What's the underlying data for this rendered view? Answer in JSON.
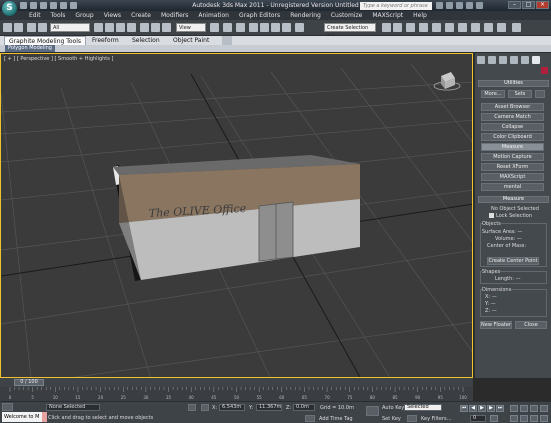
{
  "titlebar": {
    "logo_glyph": "S",
    "title": "Autodesk 3ds Max 2011 - Unregistered Version   Untitled",
    "search_placeholder": "Type a keyword or phrase",
    "window_buttons": [
      "–",
      "□",
      "×"
    ]
  },
  "menubar": {
    "items": [
      "Edit",
      "Tools",
      "Group",
      "Views",
      "Create",
      "Modifiers",
      "Animation",
      "Graph Editors",
      "Rendering",
      "Customize",
      "MAXScript",
      "Help"
    ]
  },
  "maintoolbar": {
    "selection_filter": "All",
    "ref_coord": "View",
    "named_selection": "Create Selection Set"
  },
  "ribbon": {
    "tabs": [
      "Graphite Modeling Tools",
      "Freeform",
      "Selection",
      "Object Paint"
    ],
    "active_tab": "Graphite Modeling Tools",
    "sub_label": "Polygon Modeling"
  },
  "viewport": {
    "label": "[ + ] [ Perspective ] [ Smooth + Highlights ]",
    "sign_text": "The OLIVE Office"
  },
  "cmdpanel": {
    "utilities": {
      "header": "Utilities",
      "more": "More...",
      "sets": "Sets",
      "items": [
        "Asset Browser",
        "Camera Match",
        "Collapse",
        "Color Clipboard",
        "Measure",
        "Motion Capture",
        "Reset XForm",
        "MAXScript",
        "mental"
      ]
    },
    "measure": {
      "header": "Measure",
      "no_selection": "No Object Selected",
      "lock_selection": "Lock Selection",
      "objects_group": "Objects",
      "surface_area": "Surface Area:",
      "volume": "Volume:",
      "center_of_mass": "Center of Mass:",
      "create_center_point": "Create Center Point",
      "shapes_group": "Shapes",
      "length": "Length:",
      "dimensions_group": "Dimensions",
      "x": "X:",
      "y": "Y:",
      "z": "Z:",
      "dash": "—",
      "new_floater": "New Floater",
      "close": "Close"
    }
  },
  "timeline": {
    "frame_display": "0 / 100",
    "ticks": [
      "0",
      "5",
      "10",
      "15",
      "20",
      "25",
      "30",
      "35",
      "40",
      "45",
      "50",
      "55",
      "60",
      "65",
      "70",
      "75",
      "80",
      "85",
      "90",
      "95",
      "100"
    ]
  },
  "status": {
    "welcome": "Welcome to M",
    "selection_status": "None Selected",
    "prompt": "Click and drag to select and move objects",
    "x_label": "X:",
    "x_value": "6.543m",
    "y_label": "Y:",
    "y_value": "11.367m",
    "z_label": "Z:",
    "z_value": "0.0m",
    "grid": "Grid = 10.0m",
    "add_time_tag": "Add Time Tag",
    "auto_key": "Auto Key",
    "auto_key_mode": "Selected",
    "set_key": "Set Key",
    "key_filters": "Key Filters...",
    "current_frame": "0"
  }
}
